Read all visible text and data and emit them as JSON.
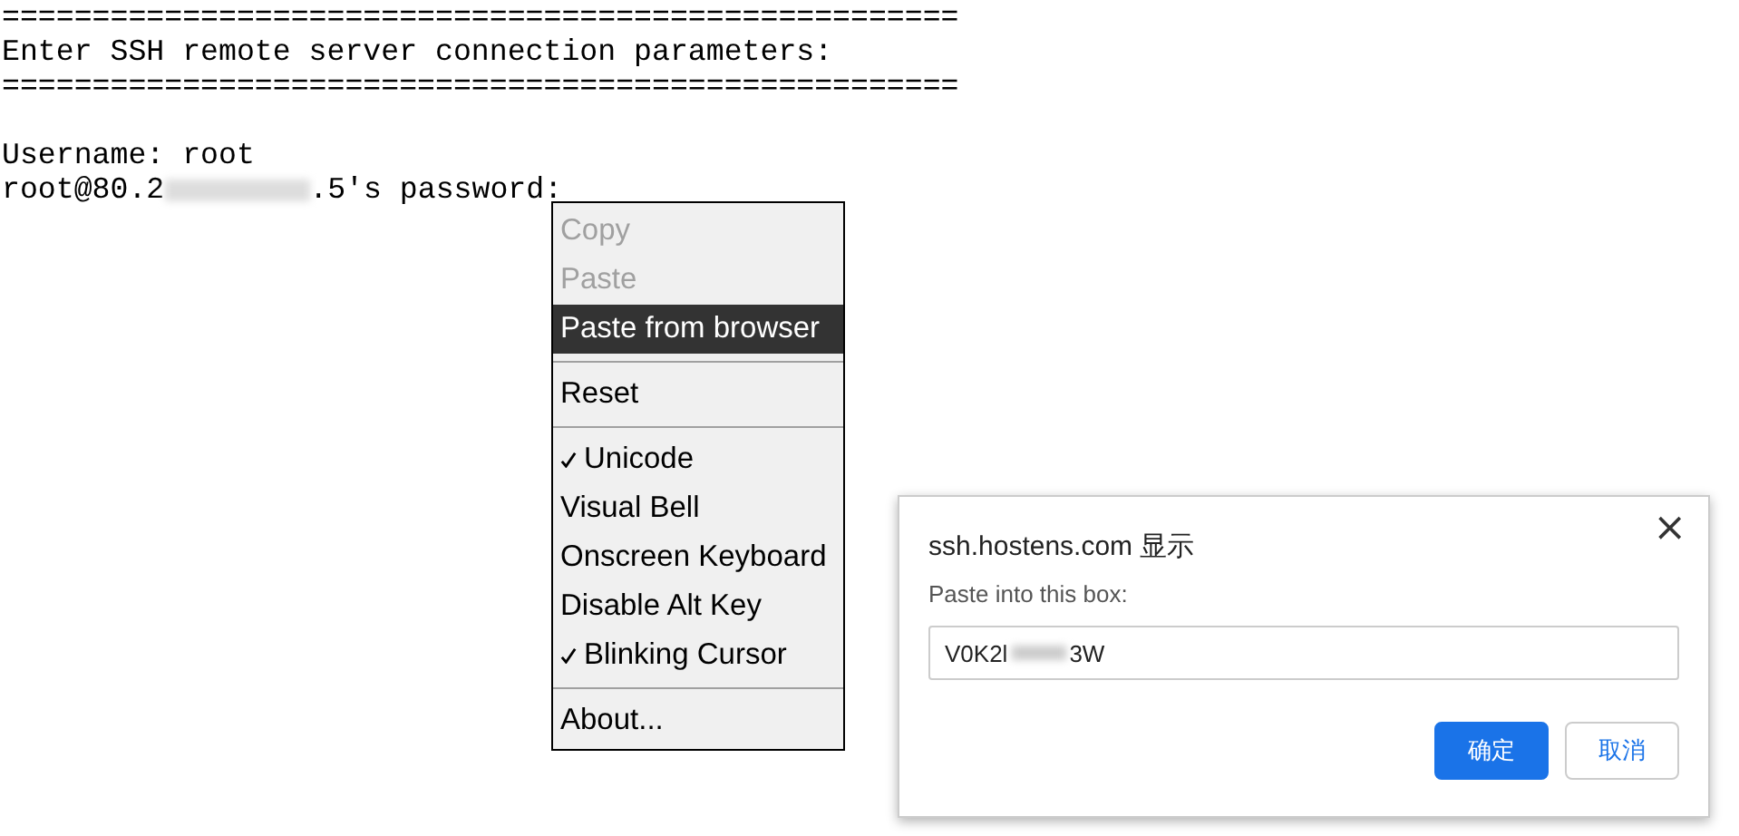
{
  "terminal": {
    "lines": [
      {
        "kind": "text",
        "parts": [
          "====================================================="
        ]
      },
      {
        "kind": "text",
        "parts": [
          "Enter SSH remote server connection parameters:"
        ]
      },
      {
        "kind": "text",
        "parts": [
          "====================================================="
        ]
      },
      {
        "kind": "blank"
      },
      {
        "kind": "text",
        "parts": [
          "Username: root"
        ]
      },
      {
        "kind": "text",
        "parts": [
          "root@80.2",
          ".5's password:"
        ]
      }
    ]
  },
  "context_menu": {
    "items": [
      {
        "kind": "item",
        "label": "Copy",
        "disabled": true,
        "selected": false,
        "checked": false
      },
      {
        "kind": "item",
        "label": "Paste",
        "disabled": true,
        "selected": false,
        "checked": false
      },
      {
        "kind": "item",
        "label": "Paste from browser",
        "disabled": false,
        "selected": true,
        "checked": false
      },
      {
        "kind": "separator"
      },
      {
        "kind": "item",
        "label": "Reset",
        "disabled": false,
        "selected": false,
        "checked": false
      },
      {
        "kind": "separator"
      },
      {
        "kind": "item",
        "label": "Unicode",
        "disabled": false,
        "selected": false,
        "checked": true
      },
      {
        "kind": "item",
        "label": "Visual Bell",
        "disabled": false,
        "selected": false,
        "checked": false
      },
      {
        "kind": "item",
        "label": "Onscreen Keyboard",
        "disabled": false,
        "selected": false,
        "checked": false
      },
      {
        "kind": "item",
        "label": "Disable Alt Key",
        "disabled": false,
        "selected": false,
        "checked": false
      },
      {
        "kind": "item",
        "label": "Blinking Cursor",
        "disabled": false,
        "selected": false,
        "checked": true
      },
      {
        "kind": "separator"
      },
      {
        "kind": "item",
        "label": "About...",
        "disabled": false,
        "selected": false,
        "checked": false
      }
    ]
  },
  "dialog": {
    "title": "ssh.hostens.com 显示",
    "close": "×",
    "label": "Paste into this box:",
    "value_parts": [
      "V0K2l",
      "3W"
    ],
    "buttons": [
      {
        "label": "确定",
        "kind": "primary"
      },
      {
        "label": "取消",
        "kind": "secondary"
      }
    ]
  }
}
